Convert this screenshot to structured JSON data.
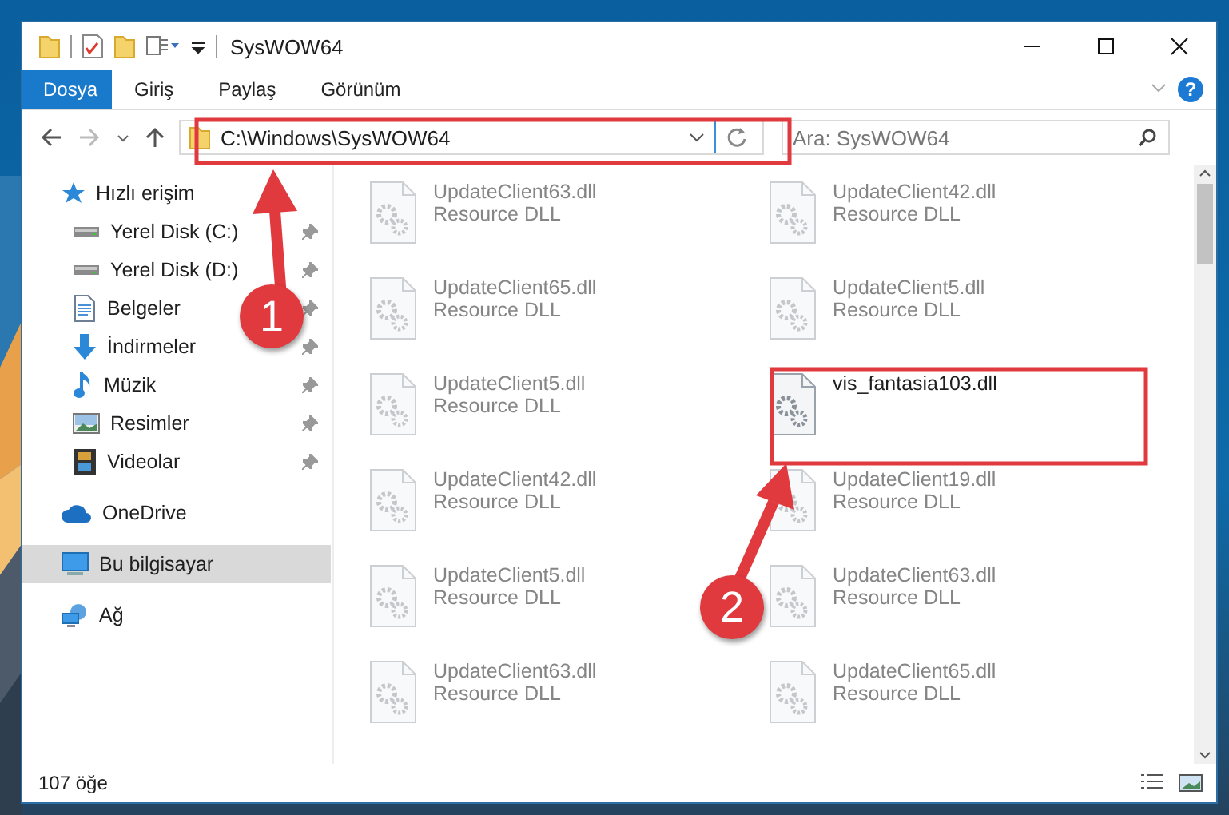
{
  "window": {
    "title": "SysWOW64"
  },
  "ribbon_tabs": [
    {
      "label": "Dosya",
      "selected": true
    },
    {
      "label": "Giriş",
      "selected": false
    },
    {
      "label": "Paylaş",
      "selected": false
    },
    {
      "label": "Görünüm",
      "selected": false
    }
  ],
  "help": "?",
  "address": {
    "path": "C:\\Windows\\SysWOW64"
  },
  "search": {
    "placeholder": "Ara: SysWOW64"
  },
  "sidebar": {
    "items": [
      {
        "label": "Hızlı erişim",
        "kind": "star",
        "selected": false,
        "children": [
          {
            "label": "Yerel Disk (C:)",
            "kind": "drive",
            "selected": false,
            "pinned": true
          },
          {
            "label": "Yerel Disk (D:)",
            "kind": "drive",
            "selected": false,
            "pinned": true
          },
          {
            "label": "Belgeler",
            "kind": "document",
            "selected": false,
            "pinned": true
          },
          {
            "label": "İndirmeler",
            "kind": "download",
            "selected": false,
            "pinned": true
          },
          {
            "label": "Müzik",
            "kind": "music",
            "selected": false,
            "pinned": true
          },
          {
            "label": "Resimler",
            "selected": false,
            "pinned": true
          },
          {
            "label": "Videolar",
            "kind": "film",
            "selected": false,
            "pinned": true
          }
        ]
      },
      {
        "label": "OneDrive",
        "kind": "cloud",
        "selected": false
      },
      {
        "label": "Bu bilgisayar",
        "kind": "computer",
        "selected": true
      },
      {
        "label": "Ağ",
        "kind": "network",
        "selected": false
      }
    ]
  },
  "files": [
    {
      "name": "UpdateClient63.dll",
      "type": "Resource DLL",
      "dimmed": true
    },
    {
      "name": "UpdateClient42.dll",
      "type": "Resource DLL",
      "dimmed": true
    },
    {
      "name": "UpdateClient65.dll",
      "type": "Resource DLL",
      "dimmed": true
    },
    {
      "name": "UpdateClient5.dll",
      "type": "Resource DLL",
      "dimmed": true
    },
    {
      "name": "UpdateClient5.dll",
      "type": "Resource DLL",
      "dimmed": true
    },
    {
      "name": "vis_fantasia103.dll",
      "dimmed": false
    },
    {
      "name": "UpdateClient42.dll",
      "type": "Resource DLL",
      "dimmed": true
    },
    {
      "name": "UpdateClient19.dll",
      "type": "Resource DLL",
      "dimmed": true
    },
    {
      "name": "UpdateClient5.dll",
      "type": "Resource DLL",
      "dimmed": true
    },
    {
      "name": "UpdateClient63.dll",
      "type": "Resource DLL",
      "dimmed": true
    },
    {
      "name": "UpdateClient63.dll",
      "type": "Resource DLL",
      "dimmed": true
    },
    {
      "name": "UpdateClient65.dll",
      "type": "Resource DLL",
      "dimmed": true
    }
  ],
  "annotations": [
    {
      "label": "1"
    },
    {
      "label": "2"
    }
  ],
  "status_bar": {
    "count": "107 öğe"
  }
}
